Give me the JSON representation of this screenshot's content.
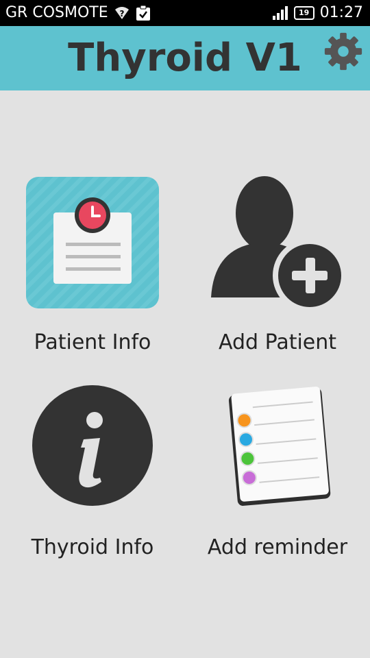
{
  "status_bar": {
    "carrier": "GR COSMOTE",
    "battery": "19",
    "time": "01:27"
  },
  "header": {
    "title": "Thyroid V1"
  },
  "menu": {
    "items": [
      {
        "label": "Patient Info",
        "icon": "clipboard-clock-icon"
      },
      {
        "label": "Add Patient",
        "icon": "add-person-icon"
      },
      {
        "label": "Thyroid Info",
        "icon": "info-icon"
      },
      {
        "label": "Add reminder",
        "icon": "reminder-list-icon"
      }
    ]
  },
  "colors": {
    "appbar": "#5ec2cf",
    "background": "#e2e2e2",
    "dark_icon": "#333333",
    "clock": "#e8475f"
  }
}
